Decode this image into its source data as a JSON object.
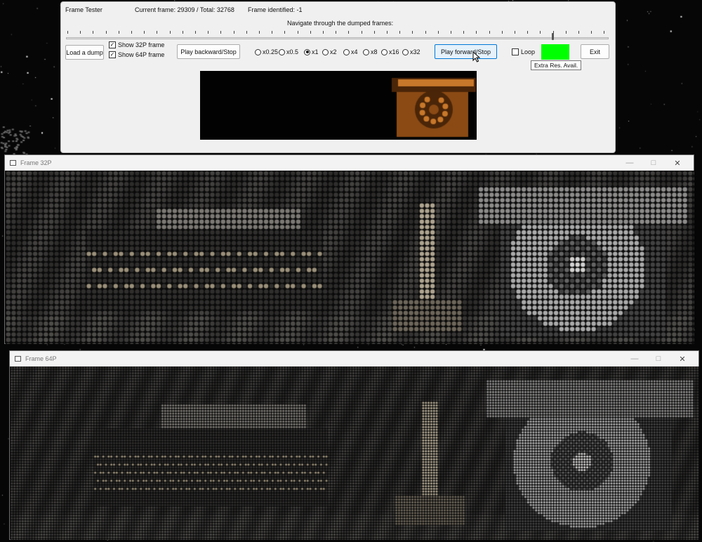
{
  "tester": {
    "title": "Frame Tester",
    "current_frame_text": "Current frame: 29309 / Total: 32768",
    "frame_identified_text": "Frame identified: -1",
    "navigate_label": "Navigate through the dumped frames:",
    "slider_position": 0.895,
    "load_button": "Load a dump",
    "show32_label": "Show 32P frame",
    "show32_checked": true,
    "show64_label": "Show 64P frame",
    "show64_checked": true,
    "play_backward_button": "Play backward/Stop",
    "speeds": [
      {
        "label": "x0.25",
        "selected": false
      },
      {
        "label": "x0.5",
        "selected": false
      },
      {
        "label": "x1",
        "selected": true
      },
      {
        "label": "x2",
        "selected": false
      },
      {
        "label": "x4",
        "selected": false
      },
      {
        "label": "x8",
        "selected": false
      },
      {
        "label": "x16",
        "selected": false
      },
      {
        "label": "x32",
        "selected": false
      }
    ],
    "play_forward_button": "Play forward/Stop",
    "loop_label": "Loop",
    "loop_checked": false,
    "status_color": "#00ff00",
    "exit_button": "Exit",
    "tooltip": "Extra Res. Avail.",
    "preview_colors": {
      "phone": "#8b4a14",
      "phone_light": "#c8782a",
      "phone_dark": "#4a2508"
    }
  },
  "win32": {
    "title": "Frame 32P",
    "controls": [
      "minimize-icon",
      "maximize-icon",
      "close-icon"
    ]
  },
  "win64": {
    "title": "Frame 64P",
    "controls": [
      "minimize-icon",
      "maximize-icon",
      "close-icon"
    ]
  },
  "colors": {
    "tester_bg": "#f0f0f0",
    "dot_base": "#2a2826",
    "dot_warm": "#d8b88a",
    "dot_light": "#dcdcdc"
  }
}
